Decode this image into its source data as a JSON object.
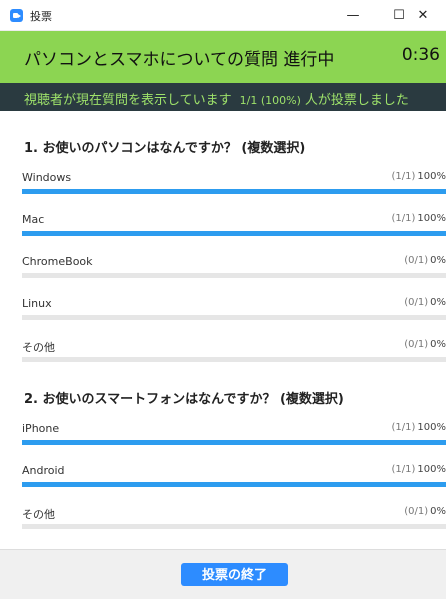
{
  "window": {
    "title": "投票",
    "minimize_glyph": "—",
    "maximize_glyph": "☐",
    "close_glyph": "✕"
  },
  "header": {
    "title": "パソコンとスマホについての質問  進行中",
    "timer": "0:36"
  },
  "status": {
    "text": "視聴者が現在質問を表示しています",
    "count": "1/1 (100%)",
    "suffix": "人が投票しました"
  },
  "questions": [
    {
      "title": "1. お使いのパソコンはなんですか？ (複数選択)",
      "answers": [
        {
          "label": "Windows",
          "count": "(1/1)",
          "percent_text": "100%",
          "percent": 100
        },
        {
          "label": "Mac",
          "count": "(1/1)",
          "percent_text": "100%",
          "percent": 100
        },
        {
          "label": "ChromeBook",
          "count": "(0/1)",
          "percent_text": "0%",
          "percent": 0
        },
        {
          "label": "Linux",
          "count": "(0/1)",
          "percent_text": "0%",
          "percent": 0
        },
        {
          "label": "その他",
          "count": "(0/1)",
          "percent_text": "0%",
          "percent": 0
        }
      ]
    },
    {
      "title": "2. お使いのスマートフォンはなんですか？ (複数選択)",
      "answers": [
        {
          "label": "iPhone",
          "count": "(1/1)",
          "percent_text": "100%",
          "percent": 100
        },
        {
          "label": "Android",
          "count": "(1/1)",
          "percent_text": "100%",
          "percent": 100
        },
        {
          "label": "その他",
          "count": "(0/1)",
          "percent_text": "0%",
          "percent": 0
        }
      ]
    }
  ],
  "footer": {
    "end_button": "投票の終了"
  },
  "colors": {
    "header_bg": "#8cd552",
    "status_bg": "#2a3a40",
    "status_text": "#9ee26a",
    "bar_fill": "#2d9cef",
    "bar_track": "#e6e6e6",
    "button_bg": "#2d8cff"
  }
}
